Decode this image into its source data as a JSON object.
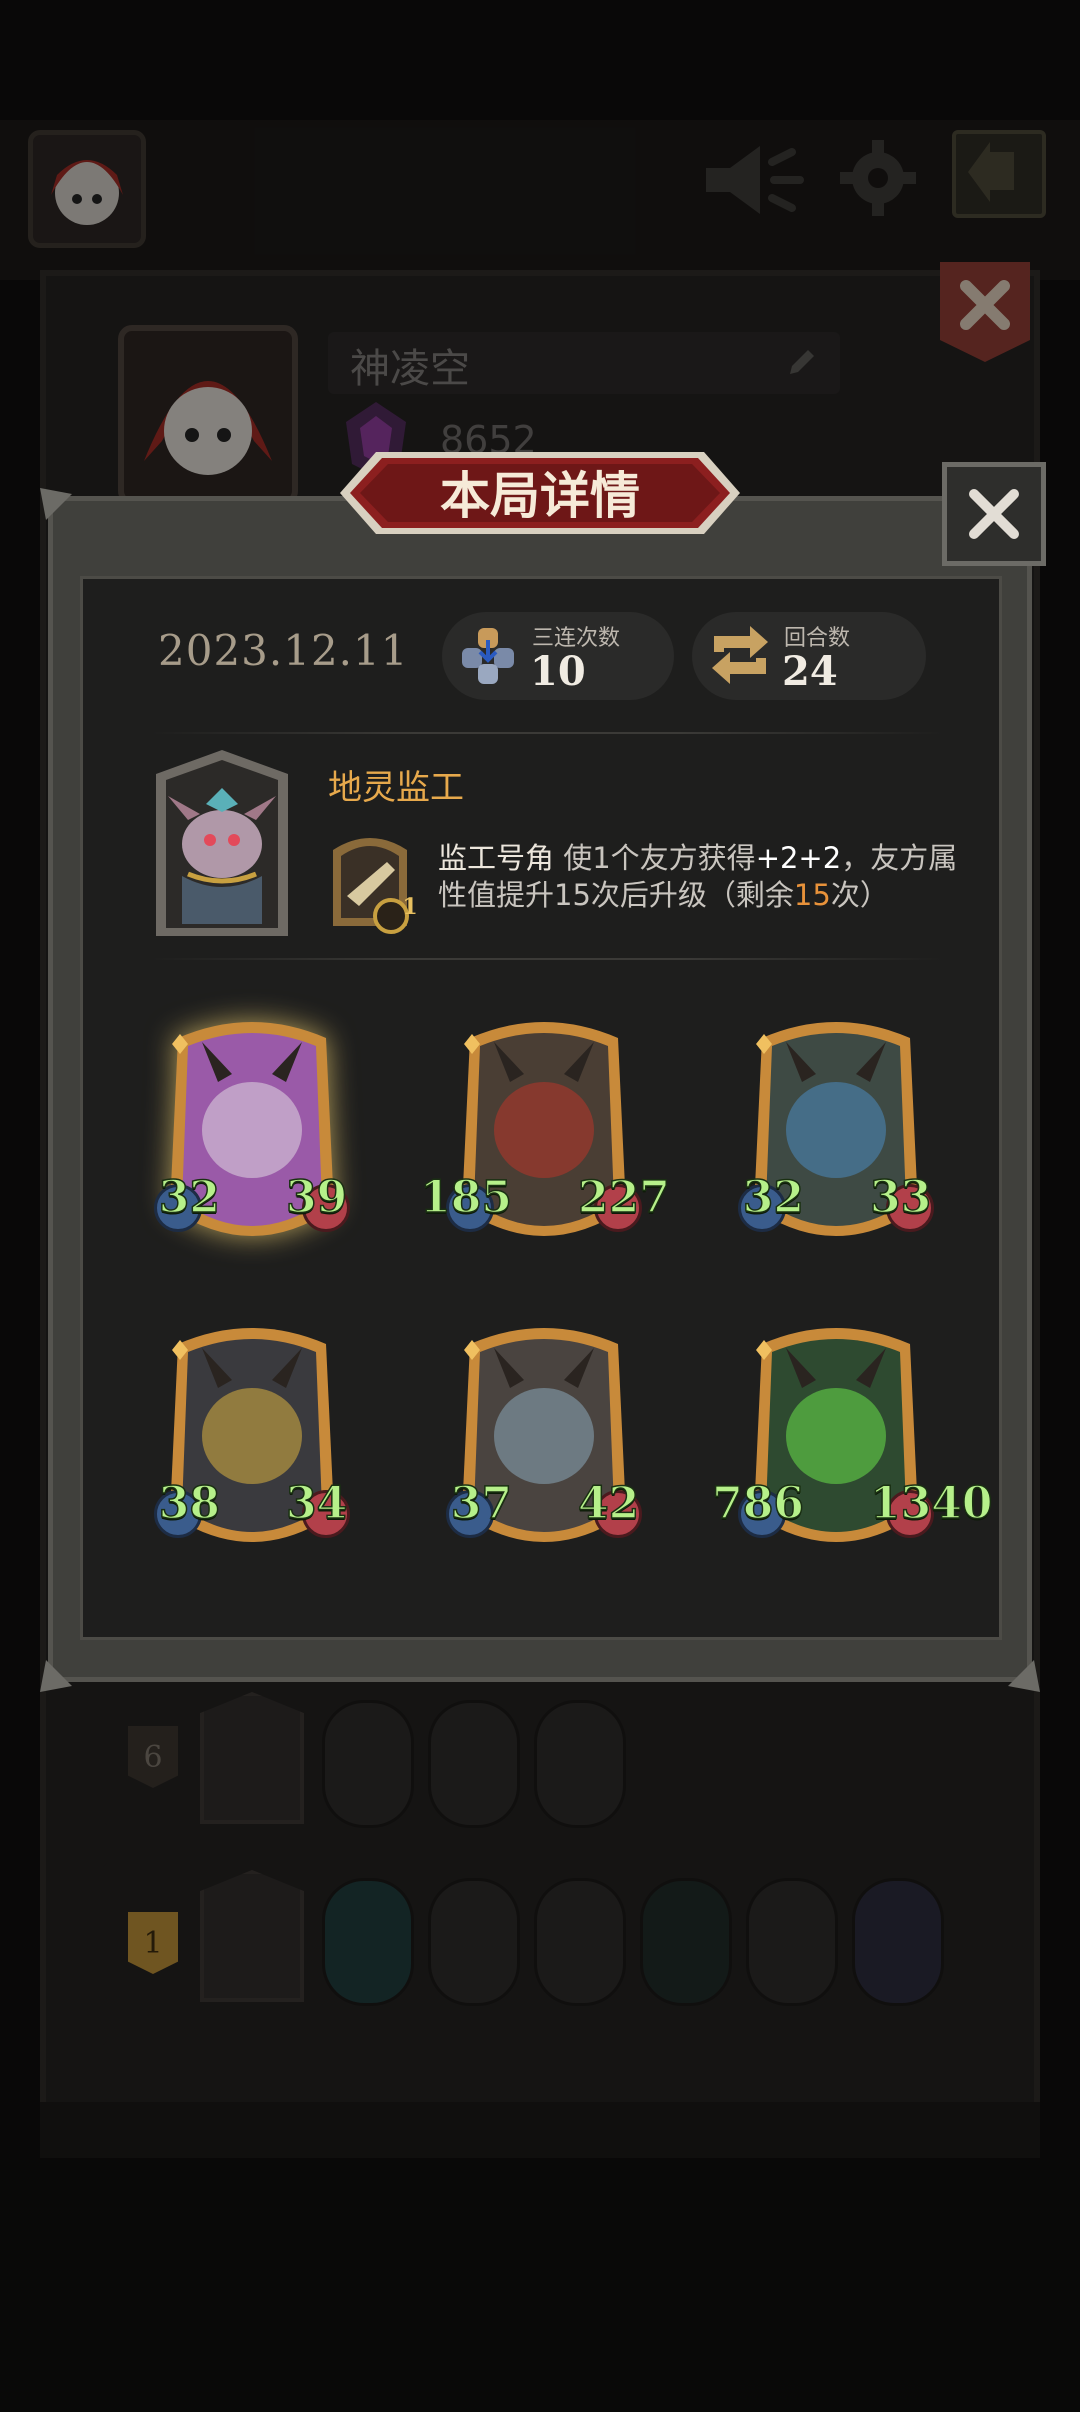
{
  "player": {
    "name": "神凌空",
    "score": "8652"
  },
  "modal": {
    "title": "本局详情",
    "date": "2023.12.11",
    "stats": [
      {
        "label": "三连次数",
        "value": "10",
        "icon": "triple-stack-icon"
      },
      {
        "label": "回合数",
        "value": "24",
        "icon": "round-cycle-icon"
      }
    ],
    "boss": {
      "name": "地灵监工",
      "item_level": "1",
      "skill_name": "监工号角",
      "skill_prefix": " 使1个友方获得",
      "skill_buff": "+2+2",
      "skill_mid": "，友方属性值提升15次后升级（剩余",
      "skill_remaining": "15",
      "skill_suffix": "次）"
    },
    "units": [
      {
        "attack": "32",
        "health": "39",
        "art": "purple-horned-dragon",
        "highlighted": true
      },
      {
        "attack": "185",
        "health": "227",
        "art": "red-serpent-dragon"
      },
      {
        "attack": "32",
        "health": "33",
        "art": "blue-wyvern"
      },
      {
        "attack": "38",
        "health": "34",
        "art": "golden-knight"
      },
      {
        "attack": "37",
        "health": "42",
        "art": "horned-beast"
      },
      {
        "attack": "786",
        "health": "1340",
        "art": "green-flame-dragon"
      }
    ]
  },
  "history": [
    {
      "rank": "6",
      "units": [
        "vulture",
        "black-panther",
        "masked-bear"
      ]
    },
    {
      "rank": "1",
      "units": [
        "teal-wraith",
        "box-automaton",
        "white-horse-rogue",
        "reaper-boat",
        "hooded-assassin",
        "pumpkin-warlock"
      ]
    }
  ],
  "colors": {
    "accent_gold": "#e7a94c",
    "stat_green": "#b6f08a",
    "banner_red": "#8c1f1f"
  }
}
